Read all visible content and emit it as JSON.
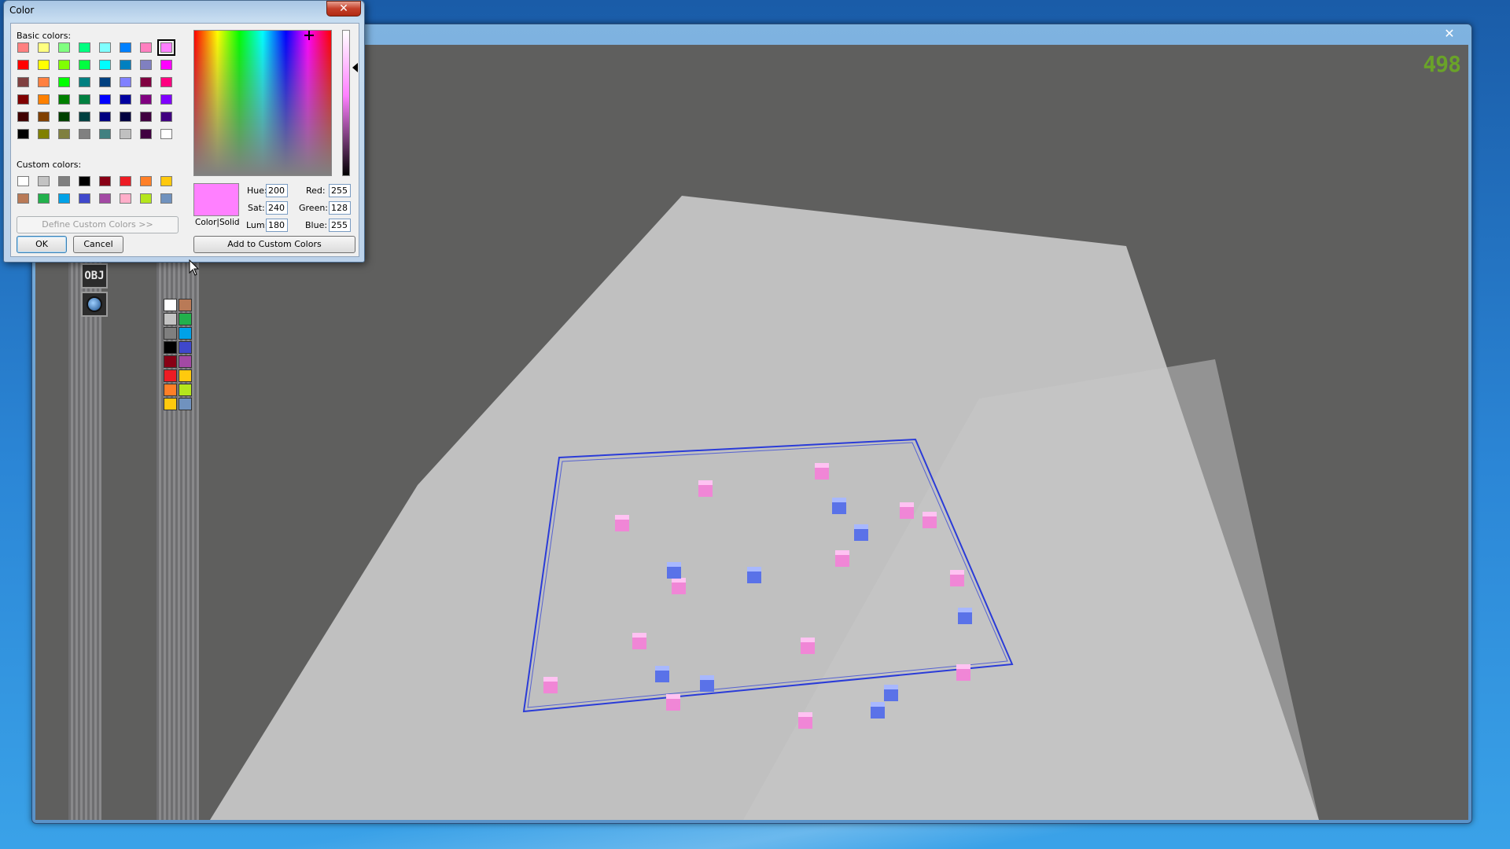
{
  "dialog": {
    "title": "Color",
    "close_glyph": "✕",
    "basic_colors_label": "Basic colors:",
    "custom_colors_label": "Custom colors:",
    "basic_colors": [
      [
        "#ff8080",
        "#ffff80",
        "#80ff80",
        "#00ff80",
        "#80ffff",
        "#0080ff",
        "#ff80c0",
        "#ff80ff"
      ],
      [
        "#ff0000",
        "#ffff00",
        "#80ff00",
        "#00ff40",
        "#00ffff",
        "#0080c0",
        "#8080c0",
        "#ff00ff"
      ],
      [
        "#804040",
        "#ff8040",
        "#00ff00",
        "#008080",
        "#004080",
        "#8080ff",
        "#800040",
        "#ff0080"
      ],
      [
        "#800000",
        "#ff8000",
        "#008000",
        "#008040",
        "#0000ff",
        "#0000a0",
        "#800080",
        "#8000ff"
      ],
      [
        "#400000",
        "#804000",
        "#004000",
        "#004040",
        "#000080",
        "#000040",
        "#400040",
        "#400080"
      ],
      [
        "#000000",
        "#808000",
        "#808040",
        "#808080",
        "#408080",
        "#c0c0c0",
        "#400040",
        "#ffffff"
      ]
    ],
    "selected_basic": [
      0,
      7
    ],
    "custom_colors": [
      [
        "#ffffff",
        "#c3c3c3",
        "#7f7f7f",
        "#000000",
        "#880015",
        "#ed1c24",
        "#ff7f27",
        "#ffc90e"
      ],
      [
        "#b97a57",
        "#22b14c",
        "#00a2e8",
        "#3f48cc",
        "#a349a4",
        "#ffaec9",
        "#b5e61d",
        "#7092be"
      ]
    ],
    "preview_color": "#ff80ff",
    "preview_label": "Color|Solid",
    "hue_label": "Hue:",
    "hue_value": "200",
    "sat_label": "Sat:",
    "sat_value": "240",
    "lum_label": "Lum:",
    "lum_value": "180",
    "red_label": "Red:",
    "red_value": "255",
    "green_label": "Green:",
    "green_value": "128",
    "blue_label": "Blue:",
    "blue_value": "255",
    "define_custom_label": "Define Custom Colors >>",
    "ok_label": "OK",
    "cancel_label": "Cancel",
    "add_custom_label": "Add to Custom Colors"
  },
  "app": {
    "close_glyph": "✕",
    "fps_counter": "498",
    "tool_obj_label": "OBJ",
    "palette_colors": [
      [
        "#ffffff",
        "#b97a57"
      ],
      [
        "#c3c3c3",
        "#22b14c"
      ],
      [
        "#7f7f7f",
        "#00a2e8"
      ],
      [
        "#000000",
        "#3f48cc"
      ],
      [
        "#880015",
        "#a349a4"
      ],
      [
        "#ed1c24",
        "#ffc90e"
      ],
      [
        "#ff7f27",
        "#b5e61d"
      ],
      [
        "#ffc90e",
        "#7092be"
      ]
    ]
  }
}
